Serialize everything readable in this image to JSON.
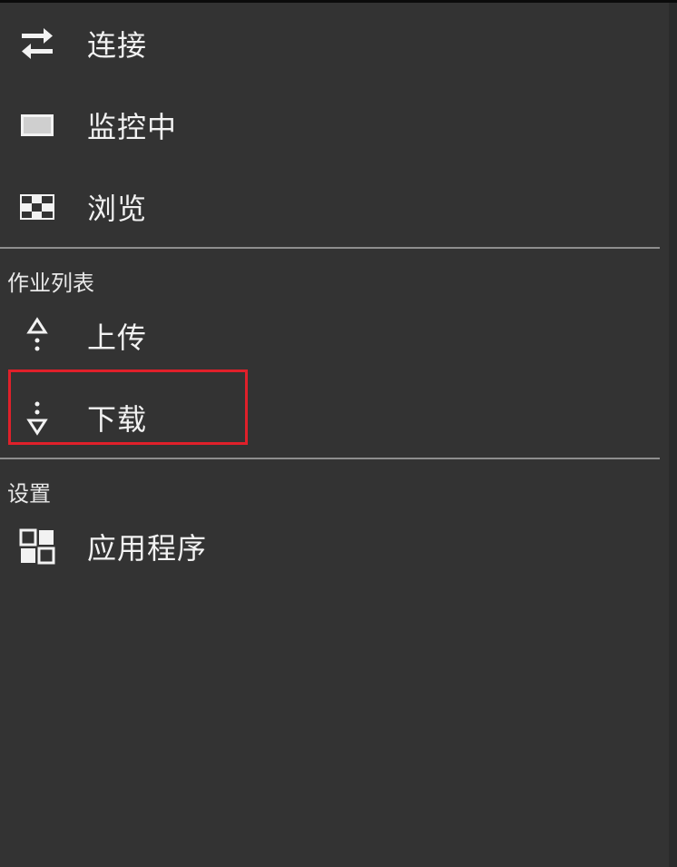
{
  "menu": {
    "top_items": [
      {
        "label": "连接",
        "icon": "connect-arrows-icon"
      },
      {
        "label": "监控中",
        "icon": "monitor-icon"
      },
      {
        "label": "浏览",
        "icon": "checkerboard-icon"
      }
    ]
  },
  "jobs_section": {
    "title": "作业列表",
    "items": [
      {
        "label": "上传",
        "icon": "upload-icon"
      },
      {
        "label": "下载",
        "icon": "download-icon"
      }
    ]
  },
  "settings_section": {
    "title": "设置",
    "items": [
      {
        "label": "应用程序",
        "icon": "app-grid-icon"
      }
    ]
  },
  "highlight_color": "#e0202a",
  "background_color": "#333333"
}
